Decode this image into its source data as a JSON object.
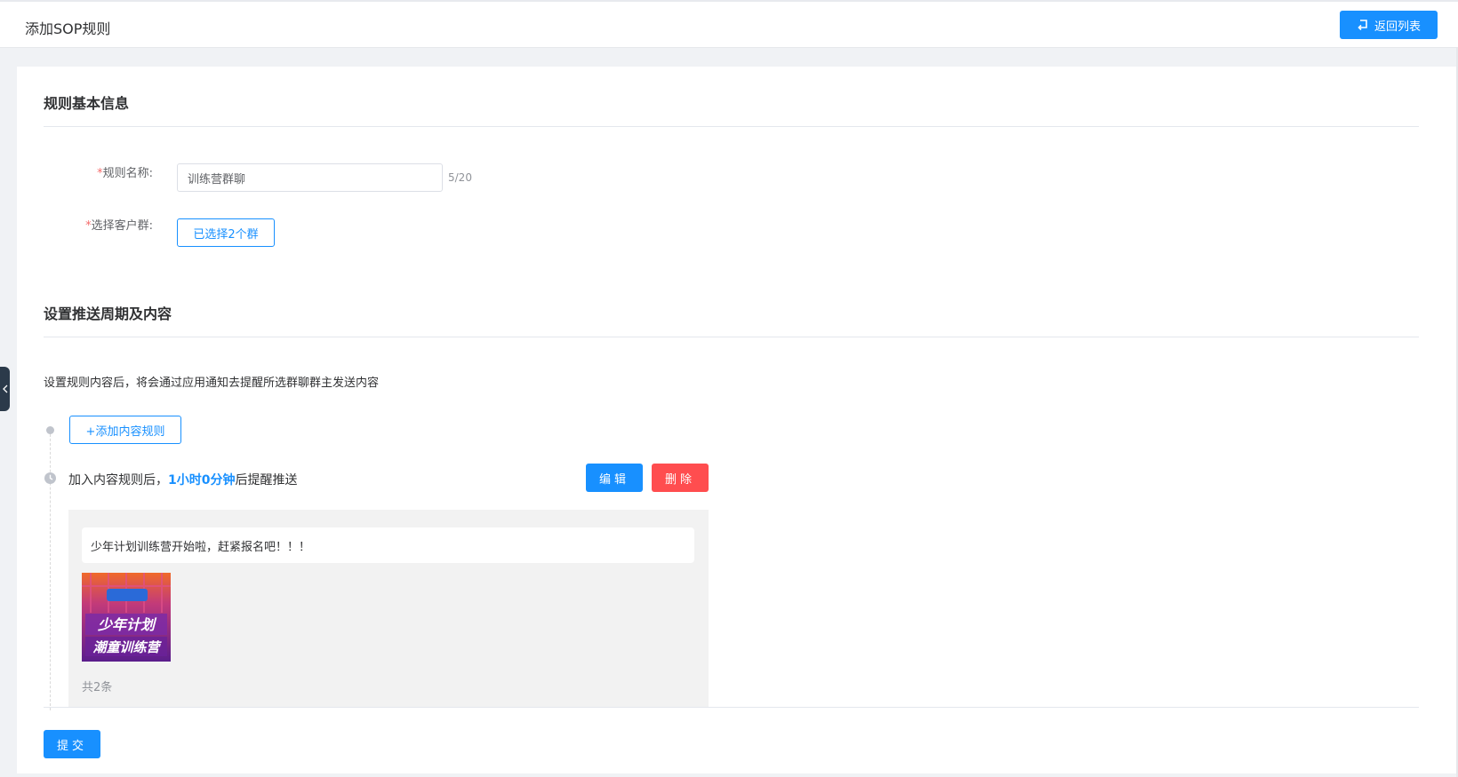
{
  "header": {
    "title": "添加SOP规则",
    "back_label": "返回列表"
  },
  "basic": {
    "title": "规则基本信息",
    "name_label": "规则名称:",
    "name_value": "训练营群聊",
    "name_count": "5/20",
    "group_label": "选择客户群:",
    "group_button": "已选择2个群"
  },
  "push": {
    "title": "设置推送周期及内容",
    "description": "设置规则内容后，将会通过应用通知去提醒所选群聊群主发送内容",
    "add_rule_label": "+添加内容规则",
    "rule_prefix": "加入内容规则后，",
    "rule_time": "1小时0分钟",
    "rule_suffix": "后提醒推送",
    "edit_label": "编辑",
    "delete_label": "删除",
    "message_text": "少年计划训练营开始啦，赶紧报名吧！！！",
    "image_caption_line1": "少年计划",
    "image_caption_line2": "潮童训练营",
    "total_label": "共2条"
  },
  "footer": {
    "submit_label": "提交"
  },
  "colors": {
    "primary": "#1890ff",
    "danger": "#ff4d4f",
    "required": "#f56c6c"
  }
}
